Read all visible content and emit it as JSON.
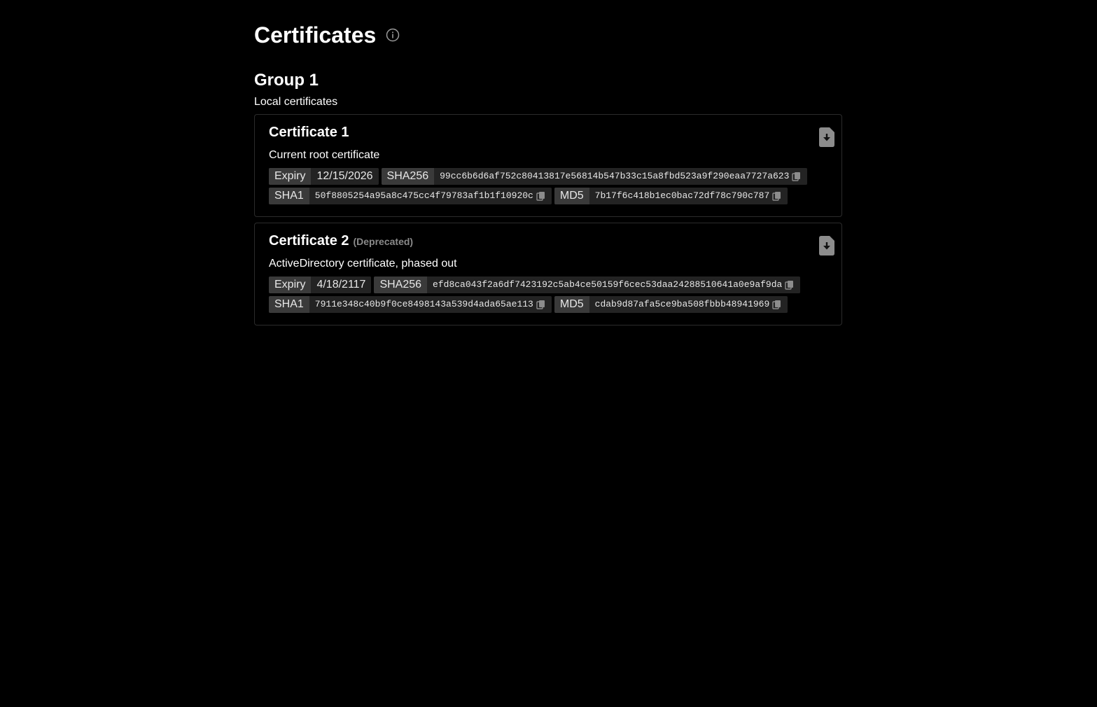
{
  "header": {
    "title": "Certificates",
    "info_icon": "info-icon"
  },
  "group": {
    "title": "Group 1",
    "subtitle": "Local certificates"
  },
  "certificates": [
    {
      "title": "Certificate 1",
      "status": "",
      "description": "Current root certificate",
      "expiry_label": "Expiry",
      "expiry": "12/15/2026",
      "sha256_label": "SHA256",
      "sha256": "99cc6b6d6af752c80413817e56814b547b33c15a8fbd523a9f290eaa7727a623",
      "sha1_label": "SHA1",
      "sha1": "50f8805254a95a8c475cc4f79783af1b1f10920c",
      "md5_label": "MD5",
      "md5": "7b17f6c418b1ec0bac72df78c790c787"
    },
    {
      "title": "Certificate 2",
      "status": "(Deprecated)",
      "description": "ActiveDirectory certificate, phased out",
      "expiry_label": "Expiry",
      "expiry": "4/18/2117",
      "sha256_label": "SHA256",
      "sha256": "efd8ca043f2a6df7423192c5ab4ce50159f6cec53daa24288510641a0e9af9da",
      "sha1_label": "SHA1",
      "sha1": "7911e348c40b9f0ce8498143a539d4ada65ae113",
      "md5_label": "MD5",
      "md5": "cdab9d87afa5ce9ba508fbbb48941969"
    }
  ]
}
